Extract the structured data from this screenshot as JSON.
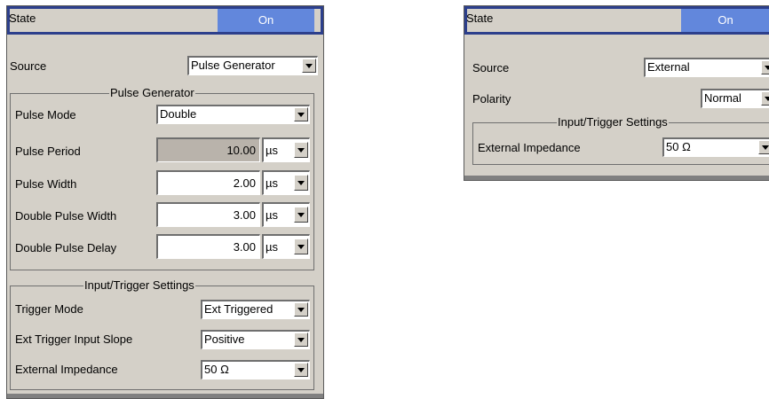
{
  "left_panel": {
    "state": {
      "label": "State",
      "value": "On"
    },
    "source": {
      "label": "Source",
      "value": "Pulse Generator"
    },
    "pulse_generator": {
      "title": "Pulse Generator",
      "pulse_mode": {
        "label": "Pulse Mode",
        "value": "Double"
      },
      "pulse_period": {
        "label": "Pulse Period",
        "value": "10.00",
        "unit": "µs"
      },
      "pulse_width": {
        "label": "Pulse Width",
        "value": "2.00",
        "unit": "µs"
      },
      "double_pulse_width": {
        "label": "Double Pulse Width",
        "value": "3.00",
        "unit": "µs"
      },
      "double_pulse_delay": {
        "label": "Double Pulse Delay",
        "value": "3.00",
        "unit": "µs"
      }
    },
    "input_trigger": {
      "title": "Input/Trigger Settings",
      "trigger_mode": {
        "label": "Trigger Mode",
        "value": "Ext Triggered"
      },
      "ext_trigger_input_slope": {
        "label": "Ext Trigger Input Slope",
        "value": "Positive"
      },
      "external_impedance": {
        "label": "External Impedance",
        "value": "50 Ω"
      }
    }
  },
  "right_panel": {
    "state": {
      "label": "State",
      "value": "On"
    },
    "source": {
      "label": "Source",
      "value": "External"
    },
    "polarity": {
      "label": "Polarity",
      "value": "Normal"
    },
    "input_trigger": {
      "title": "Input/Trigger Settings",
      "external_impedance": {
        "label": "External Impedance",
        "value": "50 Ω"
      }
    }
  },
  "colors": {
    "panel_bg": "#d4d0c8",
    "state_frame": "#2c3f8c",
    "state_button": "#6287dc",
    "readonly_field": "#b9b3ab"
  }
}
